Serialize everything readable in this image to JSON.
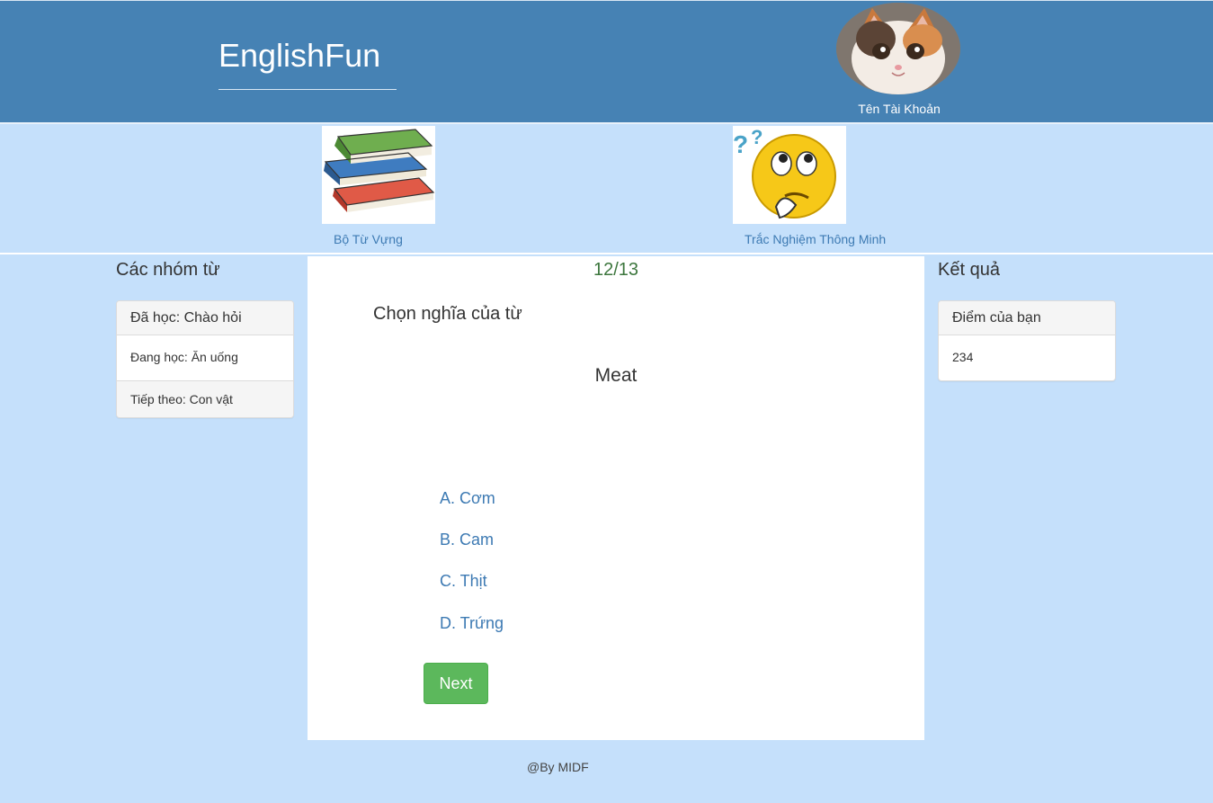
{
  "header": {
    "brand": "EnglishFun",
    "account_name": "Tên Tài Khoản",
    "avatar_icon": "cat-avatar-icon"
  },
  "nav": {
    "items": [
      {
        "label": "Bộ Từ Vựng",
        "icon": "books-icon"
      },
      {
        "label": "Trắc Nghiệm Thông Minh",
        "icon": "thinking-smiley-icon"
      }
    ]
  },
  "groups": {
    "title": "Các nhóm từ",
    "learned": "Đã học: Chào hỏi",
    "learning": "Đang học: Ăn uống",
    "next": "Tiếp theo: Con vật"
  },
  "quiz": {
    "progress": "12/13",
    "prompt": "Chọn nghĩa của từ",
    "word": "Meat",
    "options": [
      "A. Cơm",
      "B. Cam",
      "C. Thịt",
      "D. Trứng"
    ],
    "next_label": "Next"
  },
  "results": {
    "title": "Kết quả",
    "score_label": "Điểm của bạn",
    "score_value": "234"
  },
  "footer": {
    "text": "@By MIDF"
  },
  "colors": {
    "header_bg": "#4682b4",
    "page_bg": "#c5e0fb",
    "link": "#3d7ab3",
    "progress": "#3c763d",
    "next_button": "#5cb85c"
  }
}
